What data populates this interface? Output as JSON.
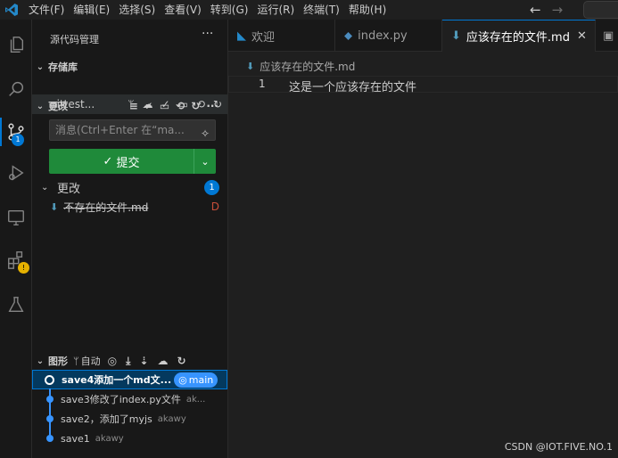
{
  "menu": [
    "文件(F)",
    "编辑(E)",
    "选择(S)",
    "查看(V)",
    "转到(G)",
    "运行(R)",
    "终端(T)",
    "帮助(H)"
  ],
  "nav": {
    "back": "←",
    "forward": "→"
  },
  "activity": {
    "scm_badge": "1"
  },
  "sidebar": {
    "title": "源代码管理",
    "more": "···",
    "repos_header": "存储库",
    "repo_name": "gittest...",
    "repo_branch_glyph": "ᛘ",
    "changes_header": "更改",
    "message_placeholder": "消息(Ctrl+Enter 在“ma...",
    "commit_label": "提交",
    "changes_group": "更改",
    "changes_count": "1",
    "file_name": "不存在的文件.md",
    "file_status": "D"
  },
  "graph": {
    "header": "图形",
    "auto_label": "自动",
    "commits": [
      {
        "message": "save4添加一个md文...",
        "author": "",
        "branch": "main"
      },
      {
        "message": "save3修改了index.py文件",
        "author": "ak..."
      },
      {
        "message": "save2，添加了myjs",
        "author": "akawy"
      },
      {
        "message": "save1",
        "author": "akawy"
      }
    ]
  },
  "tabs": [
    {
      "label": "欢迎"
    },
    {
      "label": "index.py"
    },
    {
      "label": "应该存在的文件.md"
    }
  ],
  "editor": {
    "breadcrumb": "应该存在的文件.md",
    "line_number": "1",
    "line_text": "这是一个应该存在的文件"
  },
  "watermark": "CSDN @IOT.FIVE.NO.1",
  "colors": {
    "accent": "#0078d4",
    "commit_green": "#1f8a3a",
    "deleted": "#c74e39"
  }
}
